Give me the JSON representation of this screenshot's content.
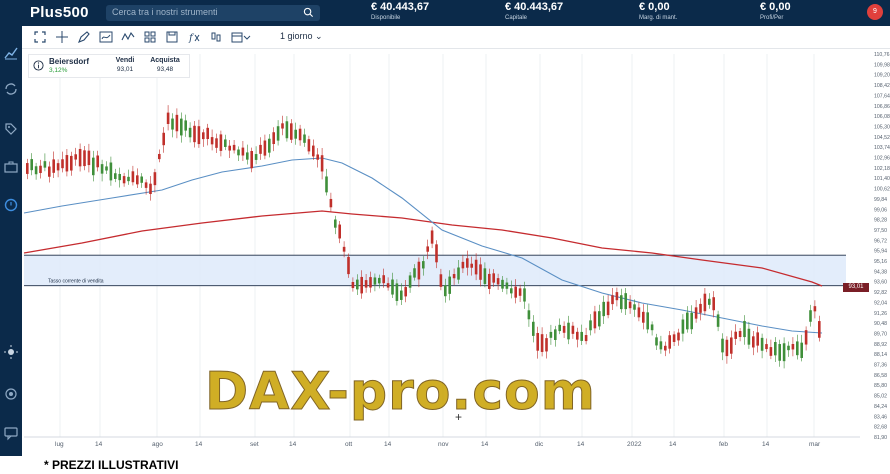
{
  "header": {
    "logo": "Plus500",
    "search_placeholder": "Cerca tra i nostri strumenti",
    "stats": [
      {
        "value": "€ 40.443,67",
        "label": "Disponibile"
      },
      {
        "value": "€ 40.443,67",
        "label": "Capitale"
      },
      {
        "value": "€ 0,00",
        "label": "Marg. di mant."
      },
      {
        "value": "€ 0,00",
        "label": "Profi/Per"
      }
    ],
    "notification_count": "9"
  },
  "toolbar": {
    "period": "1 giorno"
  },
  "instrument": {
    "name": "Beiersdorf",
    "change": "3,12%",
    "sell_label": "Vendi",
    "sell_value": "93,01",
    "buy_label": "Acquista",
    "buy_value": "93,48"
  },
  "chart": {
    "current_rate_label": "Tasso corrente di vendita",
    "price_badge": "93,01",
    "y_ticks": [
      "110,76",
      "109,98",
      "109,20",
      "108,42",
      "107,64",
      "106,86",
      "106,08",
      "105,30",
      "104,52",
      "103,74",
      "102,96",
      "102,18",
      "101,40",
      "100,62",
      "99,84",
      "99,06",
      "98,28",
      "97,50",
      "96,72",
      "95,94",
      "95,16",
      "94,38",
      "93,60",
      "92,82",
      "92,04",
      "91,26",
      "90,48",
      "89,70",
      "88,92",
      "88,14",
      "87,36",
      "86,58",
      "85,80",
      "85,02",
      "84,24",
      "83,46",
      "82,68",
      "81,90"
    ],
    "x_labels": [
      "lug",
      "14",
      "ago",
      "14",
      "set",
      "14",
      "ott",
      "14",
      "nov",
      "14",
      "dic",
      "14",
      "2022",
      "14",
      "feb",
      "14",
      "mar"
    ],
    "colors": {
      "up": "#3f8f3a",
      "down": "#c0302b",
      "ma_slow": "#c52b2f",
      "ma_fast": "#5a8fc4",
      "band": "#dce8fa"
    }
  },
  "watermark": "DAX-pro.com",
  "disclaimer": "* PREZZI ILLUSTRATIVI"
}
